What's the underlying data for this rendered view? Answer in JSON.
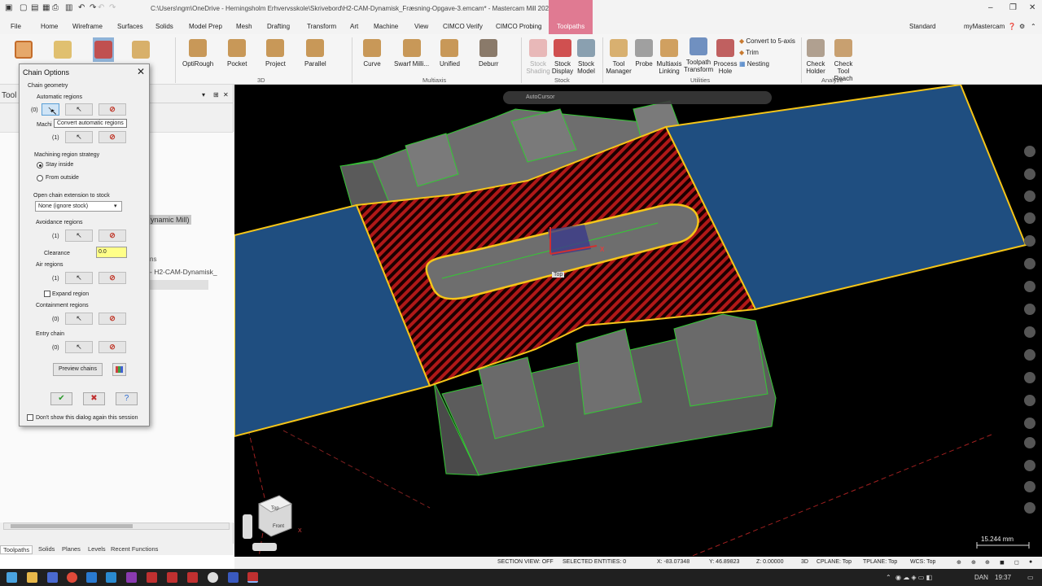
{
  "window": {
    "title": "C:\\Users\\ngm\\OneDrive - Herningsholm Erhvervsskole\\Skrivebord\\H2-CAM-Dynamisk_Fræsning-Opgave-3.emcam* - Mastercam Mill 2024",
    "workspace": "Standard",
    "account": "myMastercam"
  },
  "menu_tabs": [
    "File",
    "Home",
    "Wireframe",
    "Surfaces",
    "Solids",
    "Model Prep",
    "Mesh",
    "Drafting",
    "Transform",
    "Art",
    "Machine",
    "View",
    "CIMCO Verify",
    "CIMCO Probing",
    "Toolpaths"
  ],
  "active_tab": "Toolpaths",
  "ribbon": {
    "groups": [
      "3D",
      "Multiaxis",
      "Stock",
      "Utilities",
      "Analyze"
    ],
    "buttons_3d": [
      "OptiRough",
      "Pocket",
      "Project",
      "Parallel"
    ],
    "buttons_multiaxis": [
      "Curve",
      "Swarf Milli...",
      "Unified",
      "Deburr"
    ],
    "stock_shading": "Stock Shading",
    "stock_display": "Stock Display",
    "stock_model": "Stock Model",
    "tool_manager": "Tool Manager",
    "probe": "Probe",
    "multiaxis_linking": "Multiaxis Linking",
    "toolpath_transform": "Toolpath Transform",
    "process_hole": "Process Hole",
    "convert_5axis": "Convert to 5-axis",
    "trim": "Trim",
    "nesting": "Nesting",
    "check_holder": "Check Holder",
    "check_tool_reach": "Check Tool Reach"
  },
  "left_panel": {
    "title": "Tool",
    "tree_item_1": "ynamic Mill)",
    "tree_item_2": "- H2-CAM-Dynamisk_",
    "tree_item_3": "ns",
    "bottom_tabs": [
      "Toolpaths",
      "Solids",
      "Planes",
      "Levels",
      "Recent Functions"
    ]
  },
  "dialog": {
    "title": "Chain Options",
    "chain_geometry": "Chain geometry",
    "automatic_regions": "Automatic regions",
    "automatic_count": "(0)",
    "tooltip": "Convert automatic regions",
    "machining_regions": "Machi",
    "machining_count": "(1)",
    "strategy_label": "Machining region strategy",
    "stay_inside": "Stay inside",
    "from_outside": "From outside",
    "open_chain_label": "Open chain extension to stock",
    "open_chain_value": "None (ignore stock)",
    "avoidance_regions": "Avoidance regions",
    "avoidance_count": "(1)",
    "clearance_label": "Clearance",
    "clearance_value": "0.0",
    "air_regions": "Air regions",
    "air_count": "(1)",
    "expand_region": "Expand region",
    "containment_regions": "Containment regions",
    "containment_count": "(0)",
    "entry_chain": "Entry chain",
    "entry_count": "(0)",
    "preview_chains": "Preview chains",
    "dont_show": "Don't show this dialog again this session"
  },
  "viewport": {
    "autocursor": "AutoCursor",
    "scale": "15.244 mm",
    "view_label": "Top",
    "cube_top": "Top",
    "cube_front": "Front",
    "axis_x": "X",
    "axis_y": "Y"
  },
  "status": {
    "section_view": "SECTION VIEW: OFF",
    "selected": "SELECTED ENTITIES: 0",
    "x": "X:    -83.07348",
    "y": "Y:    46.89823",
    "z": "Z:    0.00000",
    "mode": "3D",
    "cplane": "CPLANE: Top",
    "tplane": "TPLANE: Top",
    "wcs": "WCS: Top"
  },
  "taskbar": {
    "language": "DAN",
    "time": "19:37"
  },
  "colors": {
    "active_tab": "#e07a92",
    "blue_plane": "#1f4e80",
    "chain": "#f5c518",
    "hatch_red": "#b01818",
    "part_grey": "#6e6e6e",
    "edge_green": "#34c934",
    "clearance_field": "#ffff88"
  }
}
